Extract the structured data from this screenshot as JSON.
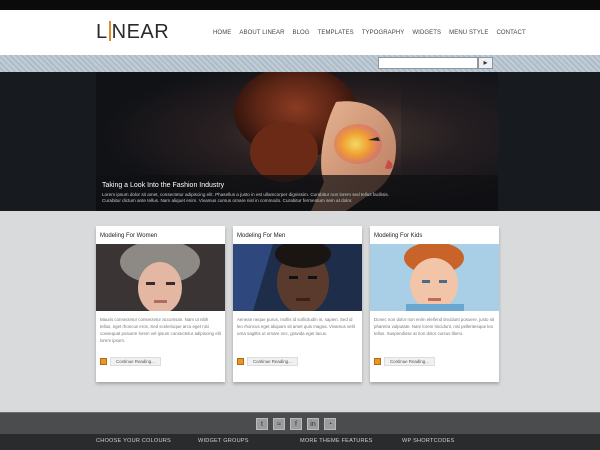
{
  "header": {
    "logo_left": "L",
    "logo_right": "NEAR",
    "nav": [
      "HOME",
      "ABOUT LINEAR",
      "BLOG",
      "TEMPLATES",
      "TYPOGRAPHY",
      "WIDGETS",
      "MENU STYLE",
      "CONTACT"
    ]
  },
  "search": {
    "placeholder": "",
    "button_icon": "search-icon"
  },
  "hero": {
    "title": "Taking a Look Into the Fashion Industry",
    "text_line1": "Lorem ipsum dolor sit amet, consectetur adipiscing elit. Phasellus a justo in est ullamcorper dignissim. Curabitur non lorem sed tellus facilisis.",
    "text_line2": "Curabitur dictum ante tellus. Nam aliquet enim. Vivamus cursus ornare nisl in commodo. Curabitur fermentum sem at dolor."
  },
  "cards": [
    {
      "title": "Modeling For Women",
      "text": "Mauris consectetur consectetur accumsan. Nam ut nibh tellus, eget rhoncus eros. Sed scelerisque arcu eget nisi consequat posuere lorem vel ipsum consectetur adipiscing elit lorem ipsum.",
      "more": "Continue Reading..."
    },
    {
      "title": "Modeling For Men",
      "text": "Aenean neque purus, mollis id sollicitudin in, sapien. Sed id leo rhoncus eget aliquam sit amet quis magna. Vivamus velit urna sagittis ut ornare nec, gravida eget lacus.",
      "more": "Continue Reading..."
    },
    {
      "title": "Modeling For Kids",
      "text": "Donec non dolor non enim eleifend tincidunt posuere. justo sit pharetra vulputate. Nam lorem tincidunt, nisi pellentesque leo tellus. Suspendisse at non dolor cursus libero.",
      "more": "Continue Reading..."
    }
  ],
  "footer": {
    "social": [
      "t",
      "rss",
      "f",
      "in",
      "rss"
    ],
    "columns": [
      "CHOOSE YOUR COLOURS",
      "WIDGET GROUPS",
      "MORE THEME FEATURES",
      "WP SHORTCODES"
    ]
  },
  "colors": {
    "accent": "#e8962a",
    "search_bar": "#b6c4cf",
    "footer": "#2a2b2d"
  }
}
